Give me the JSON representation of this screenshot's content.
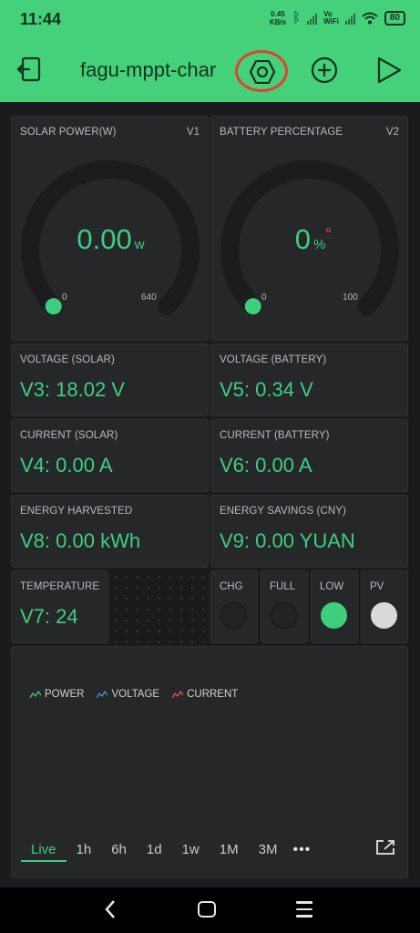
{
  "status": {
    "time": "11:44",
    "speed_value": "0.45",
    "speed_unit": "KB/s",
    "wifi_tag_1": "Vo",
    "wifi_tag_2": "WiFi",
    "battery": "80"
  },
  "appbar": {
    "title": "fagu-mppt-char"
  },
  "gauges": [
    {
      "label": "SOLAR POWER(W)",
      "pin": "V1",
      "value": "0.00",
      "unit": "w",
      "min": "0",
      "max": "640",
      "fraction": 0.0
    },
    {
      "label": "BATTERY PERCENTAGE",
      "pin": "V2",
      "value": "0",
      "unit": "%",
      "min": "0",
      "max": "100",
      "fraction": 0.0
    }
  ],
  "values": {
    "voltage_solar": {
      "label": "VOLTAGE (SOLAR)",
      "value": "V3: 18.02 V"
    },
    "voltage_battery": {
      "label": "VOLTAGE (BATTERY)",
      "value": "V5: 0.34 V"
    },
    "current_solar": {
      "label": "CURRENT (SOLAR)",
      "value": "V4: 0.00 A"
    },
    "current_battery": {
      "label": "CURRENT (BATTERY)",
      "value": "V6: 0.00 A"
    },
    "energy_harvested": {
      "label": "ENERGY HARVESTED",
      "value": "V8: 0.00 kWh"
    },
    "energy_savings": {
      "label": "ENERGY SAVINGS (CNY)",
      "value": "V9: 0.00 YUAN"
    },
    "temperature": {
      "label": "TEMPERATURE",
      "value": "V7: 24"
    }
  },
  "leds": [
    {
      "label": "CHG",
      "state": "off",
      "color": "#222325"
    },
    {
      "label": "FULL",
      "state": "off",
      "color": "#222325"
    },
    {
      "label": "LOW",
      "state": "on",
      "color": "#3ecf7e"
    },
    {
      "label": "PV",
      "state": "on",
      "color": "#d9d9d9"
    }
  ],
  "chart": {
    "legend": [
      {
        "name": "POWER",
        "color": "#3ecf7e"
      },
      {
        "name": "VOLTAGE",
        "color": "#4a90e2"
      },
      {
        "name": "CURRENT",
        "color": "#e05555"
      }
    ],
    "ranges": [
      "Live",
      "1h",
      "6h",
      "1d",
      "1w",
      "1M",
      "3M"
    ],
    "active_range": "Live",
    "more": "•••"
  },
  "colors": {
    "accent": "#45d07a",
    "value_green": "#3ecf7e",
    "background": "#1a1b1d",
    "tile": "#262729",
    "highlight_ring": "#e2412c"
  }
}
